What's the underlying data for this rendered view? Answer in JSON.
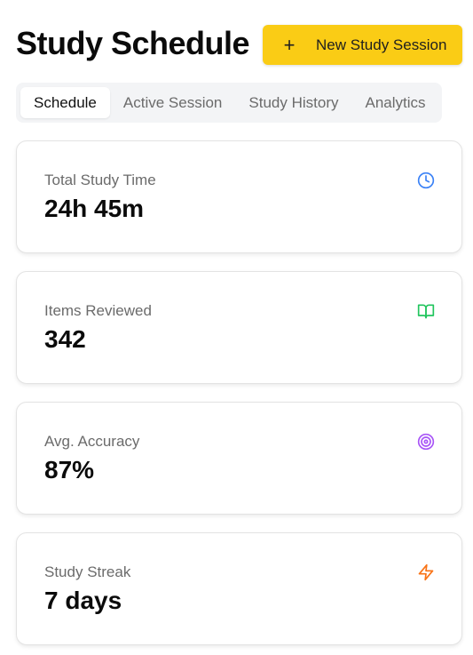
{
  "header": {
    "title": "Study Schedule",
    "new_session_button": {
      "icon": "plus-icon",
      "label": "New Study Session"
    },
    "accent_color": "#facc15"
  },
  "tabs": [
    {
      "label": "Schedule",
      "active": true
    },
    {
      "label": "Active Session",
      "active": false
    },
    {
      "label": "Study History",
      "active": false
    },
    {
      "label": "Analytics",
      "active": false
    }
  ],
  "stats": [
    {
      "label": "Total Study Time",
      "value": "24h 45m",
      "icon": "clock-icon",
      "icon_color": "#3b82f6"
    },
    {
      "label": "Items Reviewed",
      "value": "342",
      "icon": "book-open-icon",
      "icon_color": "#22c55e"
    },
    {
      "label": "Avg. Accuracy",
      "value": "87%",
      "icon": "target-icon",
      "icon_color": "#a855f7"
    },
    {
      "label": "Study Streak",
      "value": "7 days",
      "icon": "zap-icon",
      "icon_color": "#f97316"
    }
  ]
}
